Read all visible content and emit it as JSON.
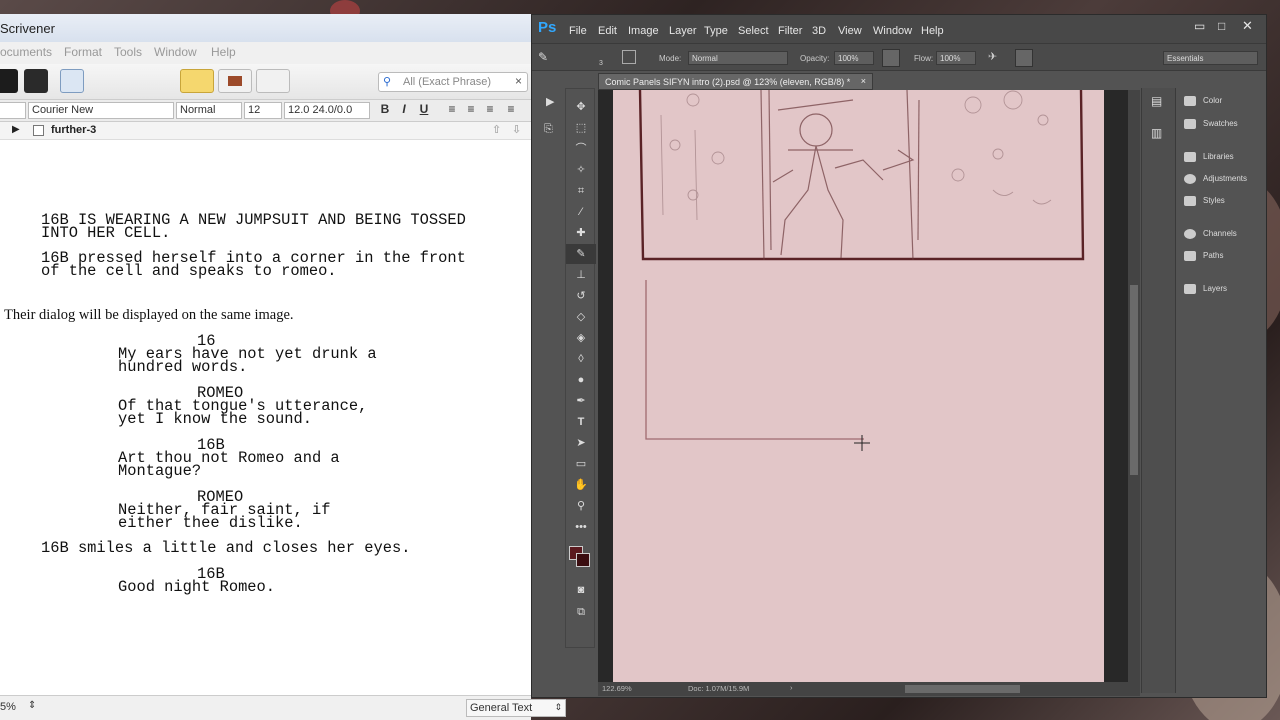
{
  "scrivener": {
    "title": "Scrivener",
    "menu": [
      "ocuments",
      "Format",
      "Tools",
      "Window",
      "Help"
    ],
    "search_placeholder": "All (Exact Phrase)",
    "font_family": "Courier New",
    "style": "Normal",
    "font_size": "12",
    "spacing": "12.0 24.0/0.0",
    "format_buttons": [
      "B",
      "I",
      "U"
    ],
    "doc_header": "further-3",
    "lines": {
      "action1a": "16B IS WEARING A NEW JUMPSUIT AND BEING TOSSED",
      "action1b": "INTO HER CELL.",
      "action2a": "16B pressed herself into a corner in the front",
      "action2b": "of the cell and speaks to romeo.",
      "note": "Their dialog will be displayed on the same image.",
      "char1": "16",
      "dial1a": "My ears have not yet drunk a",
      "dial1b": "hundred words.",
      "char2": "ROMEO",
      "dial2a": "Of that tongue's utterance,",
      "dial2b": "yet I know the sound.",
      "char3": "16B",
      "dial3a": "Art thou not Romeo and a",
      "dial3b": "Montague?",
      "char4": "ROMEO",
      "dial4a": "Neither, fair saint, if",
      "dial4b": "either thee dislike.",
      "action3": "16B smiles a little and closes her eyes.",
      "char5": "16B",
      "dial5": "Good night Romeo."
    },
    "footer": {
      "zoom": "5%",
      "text_type": "General Text"
    }
  },
  "photoshop": {
    "logo": "Ps",
    "menu": [
      "File",
      "Edit",
      "Image",
      "Layer",
      "Type",
      "Select",
      "Filter",
      "3D",
      "View",
      "Window",
      "Help"
    ],
    "options": {
      "brush_size": "3",
      "mode_label": "Mode:",
      "mode_value": "Normal",
      "opacity_label": "Opacity:",
      "opacity_value": "100%",
      "flow_label": "Flow:",
      "flow_value": "100%",
      "workspace": "Essentials"
    },
    "tab_title": "Comic Panels SIFYN intro (2).psd @ 123% (eleven, RGB/8) *",
    "status": {
      "zoom": "122.69%",
      "doc": "Doc: 1.07M/15.9M"
    },
    "panels": [
      "Color",
      "Swatches",
      "Libraries",
      "Adjustments",
      "Styles",
      "Channels",
      "Paths",
      "Layers"
    ],
    "colors": {
      "canvas": "#e2c6c8",
      "foreground": "#5b1a1f",
      "background": "#3a0d10"
    }
  }
}
